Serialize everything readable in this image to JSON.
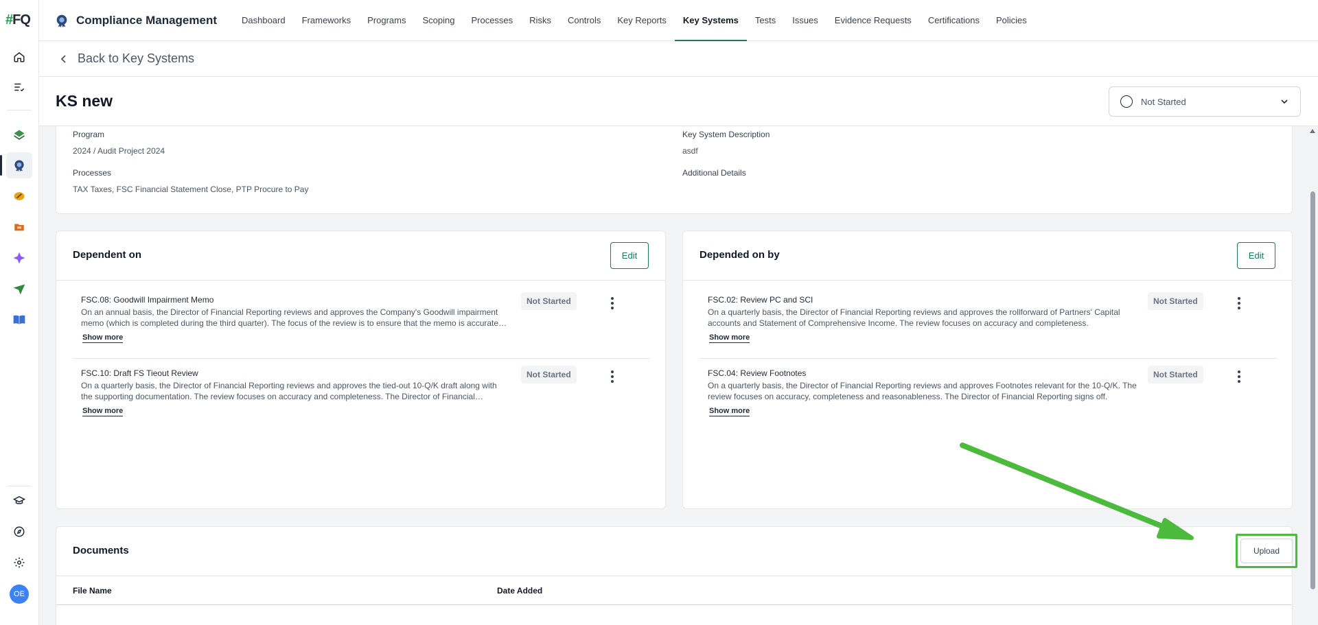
{
  "app": {
    "logo_text": "FQ",
    "title": "Compliance Management"
  },
  "nav": [
    {
      "label": "Dashboard"
    },
    {
      "label": "Frameworks"
    },
    {
      "label": "Programs"
    },
    {
      "label": "Scoping"
    },
    {
      "label": "Processes"
    },
    {
      "label": "Risks"
    },
    {
      "label": "Controls"
    },
    {
      "label": "Key Reports"
    },
    {
      "label": "Key Systems",
      "active": true
    },
    {
      "label": "Tests"
    },
    {
      "label": "Issues"
    },
    {
      "label": "Evidence Requests"
    },
    {
      "label": "Certifications"
    },
    {
      "label": "Policies"
    }
  ],
  "rail": {
    "icons": [
      "home-icon",
      "tasks-icon",
      "layers-icon",
      "compliance-icon",
      "risk-icon",
      "folder-icon",
      "sparkle-icon",
      "send-icon",
      "book-icon",
      "learn-icon",
      "compass-icon",
      "gear-icon"
    ],
    "avatar_initials": "OE"
  },
  "back_link": "Back to Key Systems",
  "page": {
    "title": "KS new",
    "status": "Not Started"
  },
  "details": {
    "program_label": "Program",
    "program_value": "2024 / Audit Project 2024",
    "processes_label": "Processes",
    "processes_value": "TAX Taxes, FSC Financial Statement Close, PTP Procure to Pay",
    "description_label": "Key System Description",
    "description_value": "asdf",
    "additional_label": "Additional Details"
  },
  "dependent_on": {
    "title": "Dependent on",
    "edit_label": "Edit",
    "items": [
      {
        "name": "FSC.08: Goodwill Impairment Memo",
        "description": "On an annual basis, the Director of Financial Reporting reviews and approves the Company's Goodwill impairment memo (which is completed during the third quarter). The focus of the review is to ensure that the memo is accurate and complete.",
        "status": "Not Started",
        "show_more": "Show more"
      },
      {
        "name": "FSC.10: Draft FS Tieout Review",
        "description": "On a quarterly basis, the Director of Financial Reporting reviews and approves the tied-out 10-Q/K draft along with the supporting documentation. The review focuses on accuracy and completeness. The Director of Financial Reporting signs off.",
        "status": "Not Started",
        "show_more": "Show more"
      }
    ]
  },
  "depended_on_by": {
    "title": "Depended on by",
    "edit_label": "Edit",
    "items": [
      {
        "name": "FSC.02: Review PC and SCI",
        "description": "On a quarterly basis, the Director of Financial Reporting reviews and approves the rollforward of Partners' Capital accounts and Statement of Comprehensive Income. The review focuses on accuracy and completeness.",
        "status": "Not Started",
        "show_more": "Show more"
      },
      {
        "name": "FSC.04: Review Footnotes",
        "description": "On a quarterly basis, the Director of Financial Reporting reviews and approves Footnotes relevant for the 10-Q/K. The review focuses on accuracy, completeness and reasonableness. The Director of Financial Reporting signs off.",
        "status": "Not Started",
        "show_more": "Show more"
      }
    ]
  },
  "documents": {
    "title": "Documents",
    "upload_label": "Upload",
    "columns": [
      "File Name",
      "Date Added"
    ]
  },
  "colors": {
    "accent": "#1a7a5a",
    "annotation": "#4cba3d"
  }
}
